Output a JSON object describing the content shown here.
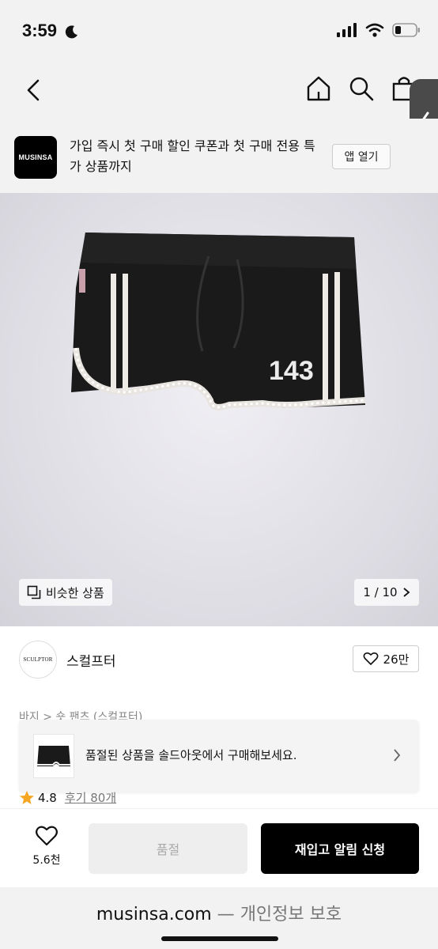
{
  "status": {
    "time": "3:59",
    "moon_icon": "moon-icon",
    "signal_icon": "signal-icon",
    "wifi_icon": "wifi-icon",
    "battery_icon": "battery-icon"
  },
  "nav": {
    "back_icon": "chevron-left-icon",
    "home_icon": "home-icon",
    "search_icon": "search-icon",
    "bag_icon": "shopping-bag-icon",
    "side_handle_icon": "chevron-left-icon"
  },
  "app_banner": {
    "logo_text": "MUSINSA",
    "message": "가입 즉시 첫 구매 할인 쿠폰과 첫 구매 전용 특가 상품까지",
    "open_label": "앱 열기"
  },
  "product": {
    "image_number_print": "143",
    "similar_label": "비슷한 상품",
    "pager": "1 / 10"
  },
  "brand": {
    "logo_text": "SCULPTOR",
    "name": "스컬프터",
    "likes": "26만"
  },
  "breadcrumb": "바지 > 숏 팬츠 (스컬프터)",
  "soldout_card": {
    "message": "품절된 상품을 솔드아웃에서 구매해보세요."
  },
  "rating": {
    "score": "4.8",
    "reviews": "후기 80개"
  },
  "bottom": {
    "like_count": "5.6천",
    "soldout_label": "품절",
    "notify_label": "재입고 알림 신청"
  },
  "url_bar": {
    "domain": "musinsa.com",
    "separator": " — ",
    "suffix": "개인정보 보호"
  },
  "colors": {
    "accent": "#000000",
    "star": "#f5a623",
    "panel_bg": "#f2f2f2"
  }
}
